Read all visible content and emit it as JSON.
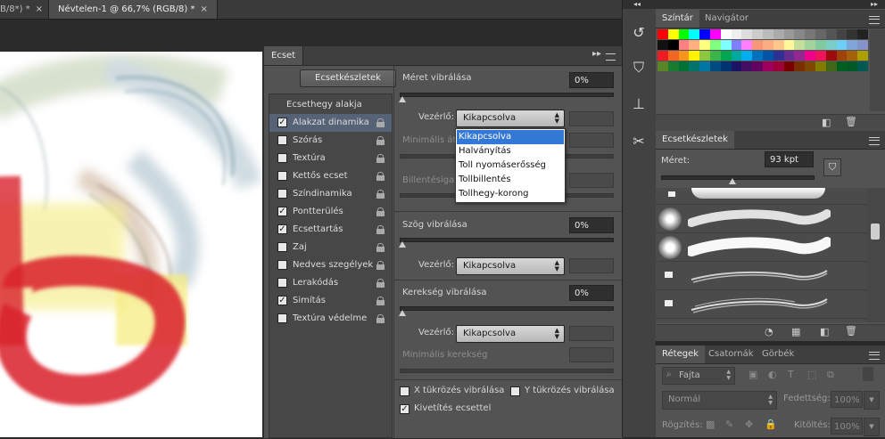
{
  "doc_tabs": [
    {
      "label": "B/8*) *",
      "close": "×"
    },
    {
      "label": "Névtelen-1 @ 66,7% (RGB/8) *",
      "close": "×"
    }
  ],
  "brush_panel": {
    "title": "Ecset",
    "presets_button": "Ecsetkészletek",
    "tip_shape_heading": "Ecsethegy alakja",
    "options": [
      {
        "label": "Alakzat dinamika",
        "checked": true,
        "selected": true
      },
      {
        "label": "Szórás",
        "checked": false
      },
      {
        "label": "Textúra",
        "checked": false
      },
      {
        "label": "Kettős ecset",
        "checked": false
      },
      {
        "label": "Színdinamika",
        "checked": false
      },
      {
        "label": "Pontterülés",
        "checked": true
      },
      {
        "label": "Ecsettartás",
        "checked": true
      },
      {
        "label": "Zaj",
        "checked": false
      },
      {
        "label": "Nedves szegélyek",
        "checked": false
      },
      {
        "label": "Lerakódás",
        "checked": false
      },
      {
        "label": "Simítás",
        "checked": true
      },
      {
        "label": "Textúra védelme",
        "checked": false
      }
    ],
    "size_jitter_label": "Méret vibrálása",
    "size_jitter_value": "0%",
    "control_label": "Vezérlő:",
    "control_value": "Kikapcsolva",
    "min_diameter_label": "Minimális átm",
    "tilt_scale_label": "Billentésigazít",
    "angle_jitter_label": "Szög vibrálása",
    "angle_jitter_value": "0%",
    "angle_control_value": "Kikapcsolva",
    "roundness_jitter_label": "Kerekség vibrálása",
    "roundness_jitter_value": "0%",
    "roundness_control_value": "Kikapcsolva",
    "min_roundness_label": "Minimális kerekség",
    "flip_x": {
      "label": "X tükrözés vibrálása",
      "checked": false
    },
    "flip_y": {
      "label": "Y tükrözés vibrálása",
      "checked": false
    },
    "brush_projection": {
      "label": "Kivetítés ecsettel",
      "checked": true
    },
    "dropdown_options": [
      "Kikapcsolva",
      "Halványítás",
      "Toll nyomáserősség",
      "Tollbillentés",
      "Tollhegy-korong"
    ],
    "dropdown_highlighted": 0
  },
  "swatches_panel": {
    "tabs": [
      "Színtár",
      "Navigátor"
    ],
    "colors": [
      "#ff0000",
      "#ffff00",
      "#00ff00",
      "#00ffff",
      "#0000ff",
      "#ff00ff",
      "#ffffff",
      "#eeeeee",
      "#dddddd",
      "#cccccc",
      "#bbbbbb",
      "#aaaaaa",
      "#999999",
      "#888888",
      "#777777",
      "#666666",
      "#555555",
      "#444444",
      "#333333",
      "#222222",
      "#111111",
      "#000000",
      "#ff8080",
      "#ffb080",
      "#ffff80",
      "#80ff80",
      "#80ffff",
      "#8080ff",
      "#ff80ff",
      "#f7977a",
      "#f9ad81",
      "#fdc68a",
      "#fff79a",
      "#c4df9b",
      "#a3d39c",
      "#82ca9d",
      "#7bcdc8",
      "#6ecff6",
      "#7ea7d8",
      "#8493ca",
      "#ed1c24",
      "#f26522",
      "#f7941d",
      "#fff200",
      "#8dc73f",
      "#39b54a",
      "#00a651",
      "#00a99d",
      "#00aeef",
      "#0072bc",
      "#0054a6",
      "#2e3192",
      "#662d91",
      "#92278f",
      "#ec008c",
      "#ed145b",
      "#9e0b0f",
      "#a0410d",
      "#a36209",
      "#aba000",
      "#598527",
      "#1a7b30",
      "#007236",
      "#00746b",
      "#0076a3",
      "#004b80",
      "#003471",
      "#1b1464",
      "#440e62",
      "#630460",
      "#9e005d",
      "#9e0039",
      "#790000",
      "#7b2e00",
      "#7d4900",
      "#827b00",
      "#406618",
      "#005e20",
      "#005826",
      "#005952"
    ],
    "new_icon": "new-swatch-icon",
    "trash_icon": "trash-icon"
  },
  "presets_panel": {
    "title": "Ecsetkészletek",
    "size_label": "Méret:",
    "size_value": "93 kpt"
  },
  "layers_panel": {
    "tabs": [
      "Rétegek",
      "Csatornák",
      "Görbék"
    ],
    "kind_label": "Fajta",
    "blend_mode": "Normál",
    "opacity_label": "Fedettség:",
    "opacity_value": "100%",
    "lock_label": "Rögzítés:",
    "fill_label": "Kitöltés:",
    "fill_value": "100%"
  }
}
